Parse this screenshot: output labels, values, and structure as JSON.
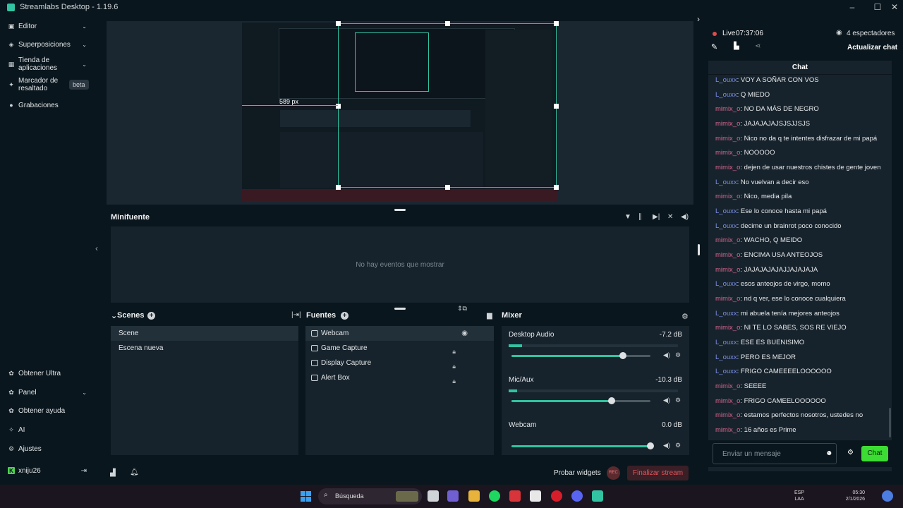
{
  "window": {
    "title": "Streamlabs Desktop - 1.19.6",
    "minimize": "–",
    "maximize": "☐",
    "close": "✕"
  },
  "sidebar": {
    "items": [
      {
        "label": "Editor",
        "icon": "layout-icon"
      },
      {
        "label": "Superposiciones",
        "icon": "overlays-icon"
      },
      {
        "label": "Tienda de aplicaciones",
        "icon": "store-icon"
      },
      {
        "label": "Marcador de resaltado",
        "icon": "highlighter-icon",
        "badge": "beta"
      },
      {
        "label": "Grabaciones",
        "icon": "recordings-icon"
      }
    ],
    "bottom": [
      {
        "label": "Obtener Ultra",
        "icon": "ultra-icon"
      },
      {
        "label": "Panel",
        "icon": "dashboard-icon"
      },
      {
        "label": "Obtener ayuda",
        "icon": "help-icon"
      },
      {
        "label": "AI",
        "icon": "ai-icon"
      },
      {
        "label": "Ajustes",
        "icon": "gear-icon"
      }
    ],
    "user": "xniju26"
  },
  "preview": {
    "readout": "589 px"
  },
  "minifuente": {
    "title": "Minifuente",
    "empty": "No hay eventos que mostrar"
  },
  "scenes": {
    "title": "Scenes",
    "items": [
      "Scene",
      "Escena nueva"
    ]
  },
  "sources": {
    "title": "Fuentes",
    "items": [
      "Webcam",
      "Game Capture",
      "Display Capture",
      "Alert Box"
    ]
  },
  "mixer": {
    "title": "Mixer",
    "channels": [
      {
        "name": "Desktop Audio",
        "db": "-7.2 dB",
        "level": 0.08,
        "volume": 0.8
      },
      {
        "name": "Mic/Aux",
        "db": "-10.3 dB",
        "level": 0.05,
        "volume": 0.72
      },
      {
        "name": "Webcam",
        "db": "0.0 dB",
        "level": 0,
        "volume": 1.0
      }
    ]
  },
  "bottom": {
    "probar": "Probar widgets",
    "rec": "REC",
    "finalizar": "Finalizar stream"
  },
  "live": {
    "status": "Live",
    "time": "07:37:06",
    "viewers": "4 espectadores",
    "refresh": "Actualizar chat"
  },
  "chat": {
    "title": "Chat",
    "placeholder": "Enviar un mensaje",
    "send": "Chat",
    "messages": [
      {
        "user": "L_ouxx",
        "text": "VOY A SOÑAR CON VOS",
        "c": 1
      },
      {
        "user": "L_ouxx",
        "text": "Q MIEDO",
        "c": 1
      },
      {
        "user": "mimix_o",
        "text": "NO DA MÁS DE NEGRO",
        "c": 2
      },
      {
        "user": "mimix_o",
        "text": "JAJAJAJAJSJSJJSJS",
        "c": 2
      },
      {
        "user": "mimix_o",
        "text": "Nico no da q te intentes disfrazar de mi papá",
        "c": 2
      },
      {
        "user": "mimix_o",
        "text": "NOOOOO",
        "c": 2
      },
      {
        "user": "mimix_o",
        "text": "dejen de usar nuestros chistes de gente joven",
        "c": 2
      },
      {
        "user": "L_ouxx",
        "text": "No vuelvan a decir eso",
        "c": 1
      },
      {
        "user": "mimix_o",
        "text": "Nico, media pila",
        "c": 2
      },
      {
        "user": "L_ouxx",
        "text": "Ese lo conoce hasta mi papá",
        "c": 1
      },
      {
        "user": "L_ouxx",
        "text": "decime un brainrot poco conocido",
        "c": 1
      },
      {
        "user": "mimix_o",
        "text": "WACHO, Q MEIDO",
        "c": 2
      },
      {
        "user": "mimix_o",
        "text": "ENCIMA USA ANTEOJOS",
        "c": 2
      },
      {
        "user": "mimix_o",
        "text": "JAJAJAJAJAJJAJAJAJA",
        "c": 2
      },
      {
        "user": "L_ouxx",
        "text": "esos anteojos de virgo, momo",
        "c": 1
      },
      {
        "user": "mimix_o",
        "text": "nd q ver, ese lo conoce cualquiera",
        "c": 2
      },
      {
        "user": "L_ouxx",
        "text": "mi abuela tenía mejores anteojos",
        "c": 1
      },
      {
        "user": "mimix_o",
        "text": "NI TE LO SABES, SOS RE VIEJO",
        "c": 2
      },
      {
        "user": "L_ouxx",
        "text": "ESE ES BUENISIMO",
        "c": 1
      },
      {
        "user": "L_ouxx",
        "text": "PERO ES MEJOR",
        "c": 1
      },
      {
        "user": "L_ouxx",
        "text": "FRIGO CAMEEEELOOOOOO",
        "c": 1
      },
      {
        "user": "mimix_o",
        "text": "SEEEE",
        "c": 2
      },
      {
        "user": "mimix_o",
        "text": "FRIGO CAMEELOOOOOO",
        "c": 2
      },
      {
        "user": "mimix_o",
        "text": "estamos perfectos nosotros, ustedes no",
        "c": 2
      },
      {
        "user": "mimix_o",
        "text": "16 años es Prime",
        "c": 2
      }
    ]
  },
  "taskbar": {
    "search": "Búsqueda",
    "lang1": "ESP",
    "lang2": "LAA",
    "time": "05:30",
    "date": "2/1/2026"
  },
  "colors": {
    "accent": "#31c3a2",
    "live": "#e04b4b",
    "send": "#3ddc34",
    "username1": "#7c8fe6",
    "username2": "#d8658e",
    "finalizar": "#d8434b"
  }
}
